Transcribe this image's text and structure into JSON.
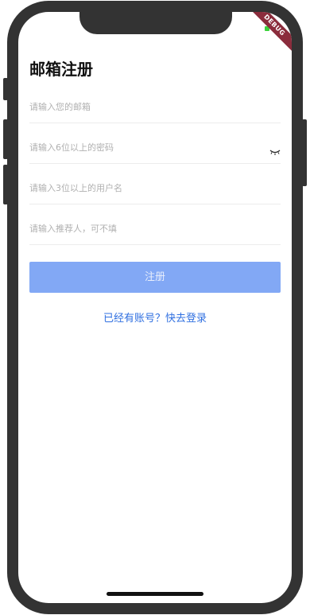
{
  "app": {
    "title": "邮箱注册",
    "debug_banner": "DEBUG"
  },
  "form": {
    "email": {
      "placeholder": "请输入您的邮箱",
      "value": ""
    },
    "password": {
      "placeholder": "请输入6位以上的密码",
      "value": "",
      "toggle_icon": "eye-closed-icon"
    },
    "username": {
      "placeholder": "请输入3位以上的用户名",
      "value": ""
    },
    "referrer": {
      "placeholder": "请输入推荐人，可不填",
      "value": ""
    },
    "submit_label": "注册",
    "login_link": "已经有账号？快去登录"
  },
  "colors": {
    "accent": "#82a8f5",
    "link": "#2f6fe0",
    "placeholder": "#b0b0b0"
  }
}
